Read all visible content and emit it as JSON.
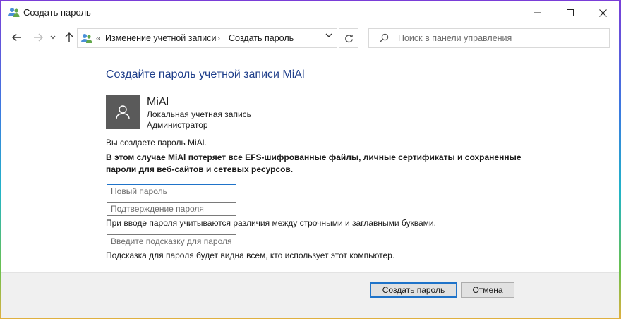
{
  "window": {
    "title": "Создать пароль",
    "controls": {
      "minimize": "—",
      "maximize": "☐",
      "close": "✕"
    }
  },
  "nav": {
    "breadcrumb": [
      "Изменение учетной записи",
      "Создать пароль"
    ],
    "search_placeholder": "Поиск в панели управления"
  },
  "page": {
    "heading": "Создайте пароль учетной записи MiAl",
    "user": {
      "name": "MiAl",
      "type": "Локальная учетная запись",
      "role": "Администратор"
    },
    "info": "Вы создаете пароль MiAl.",
    "warning": "В этом случае MiAl потеряет все EFS-шифрованные файлы, личные сертификаты и сохраненные пароли для веб-сайтов и сетевых ресурсов.",
    "fields": {
      "new_password": {
        "placeholder": "Новый пароль",
        "value": ""
      },
      "confirm_password": {
        "placeholder": "Подтверждение пароля",
        "value": ""
      },
      "hint": {
        "placeholder": "Введите подсказку для пароля",
        "value": ""
      }
    },
    "case_note": "При вводе пароля учитываются различия между строчными и заглавными буквами.",
    "hint_note": "Подсказка для пароля будет видна всем, кто использует этот компьютер."
  },
  "buttons": {
    "create": "Создать пароль",
    "cancel": "Отмена"
  },
  "colors": {
    "heading": "#1e3e8a",
    "focus_accent": "#1f73c9",
    "avatar_bg": "#5a5a5a"
  }
}
